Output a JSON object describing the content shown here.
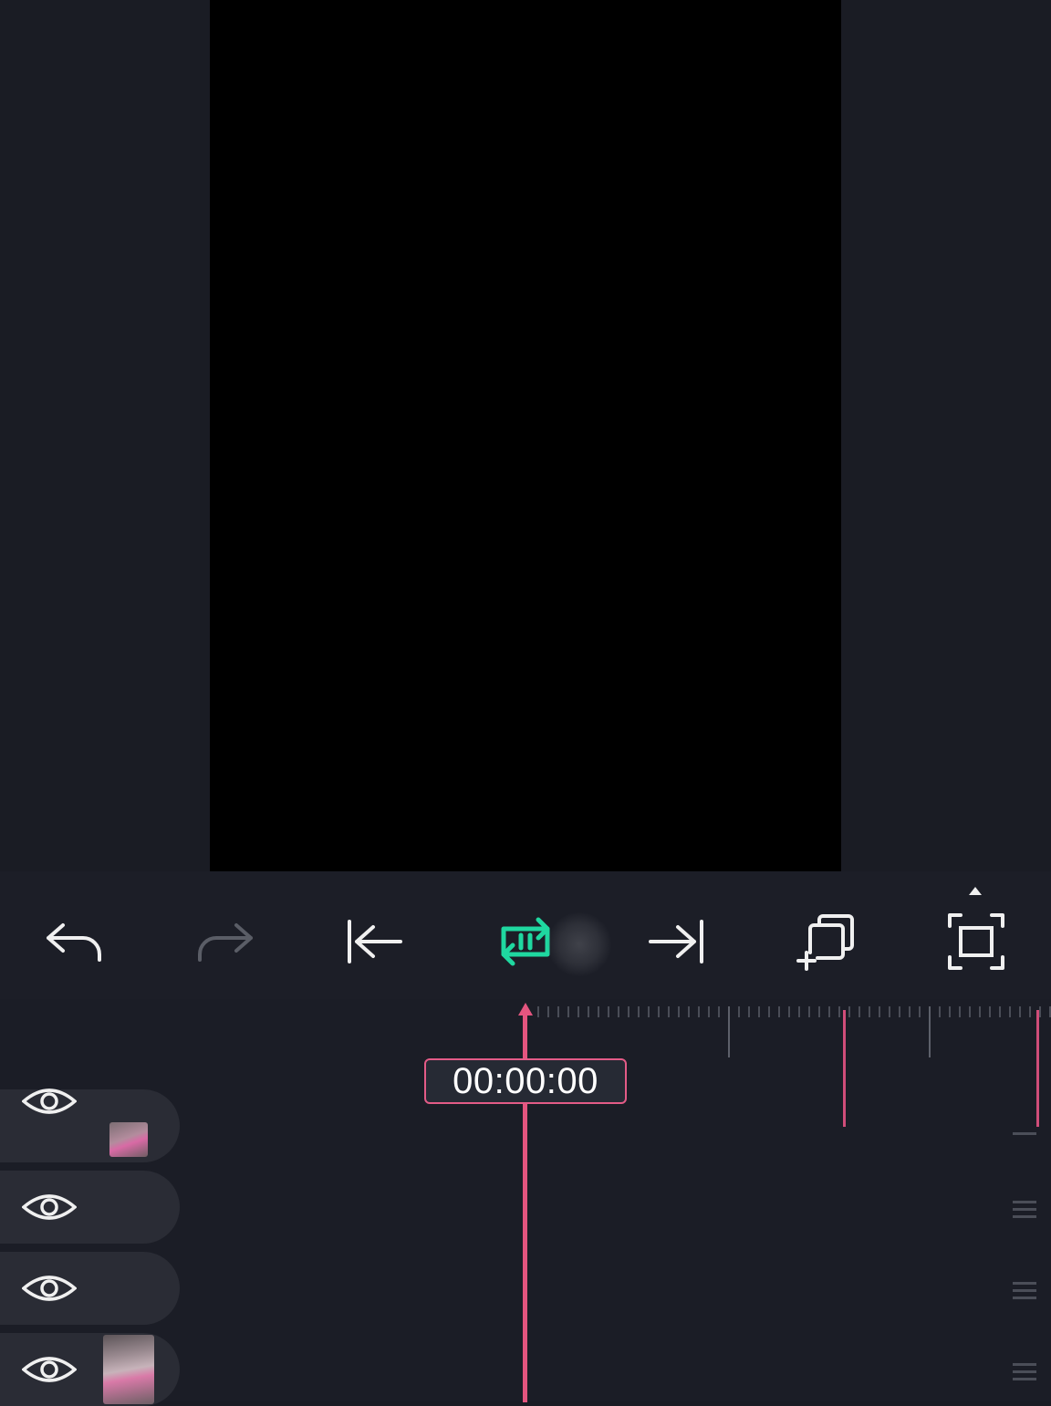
{
  "app": "video-editor",
  "toolbar": {
    "buttons": [
      {
        "name": "undo",
        "icon": "undo-icon",
        "enabled": true
      },
      {
        "name": "redo",
        "icon": "redo-icon",
        "enabled": false
      },
      {
        "name": "jump-to-start",
        "icon": "jump-to-start-icon",
        "enabled": true
      },
      {
        "name": "loop-play",
        "icon": "loop-play-icon",
        "enabled": true,
        "active": true
      },
      {
        "name": "jump-to-end",
        "icon": "jump-to-end-icon",
        "enabled": true
      },
      {
        "name": "add-layer",
        "icon": "add-layer-icon",
        "enabled": true
      },
      {
        "name": "fullscreen",
        "icon": "fullscreen-icon",
        "enabled": true
      }
    ]
  },
  "timeline": {
    "current_time": "00:00:00",
    "tracks": [
      {
        "visible": true,
        "has_thumbnail": true
      },
      {
        "visible": true,
        "has_thumbnail": false
      },
      {
        "visible": true,
        "has_thumbnail": false
      },
      {
        "visible": true,
        "has_thumbnail": true
      }
    ]
  },
  "colors": {
    "background": "#1a1c24",
    "canvas": "#000000",
    "accent_pink": "#e4557f",
    "accent_green": "#1fd8a0",
    "icon": "#f0f0f0",
    "icon_disabled": "#5a5d66",
    "track_header": "#2a2c35"
  }
}
